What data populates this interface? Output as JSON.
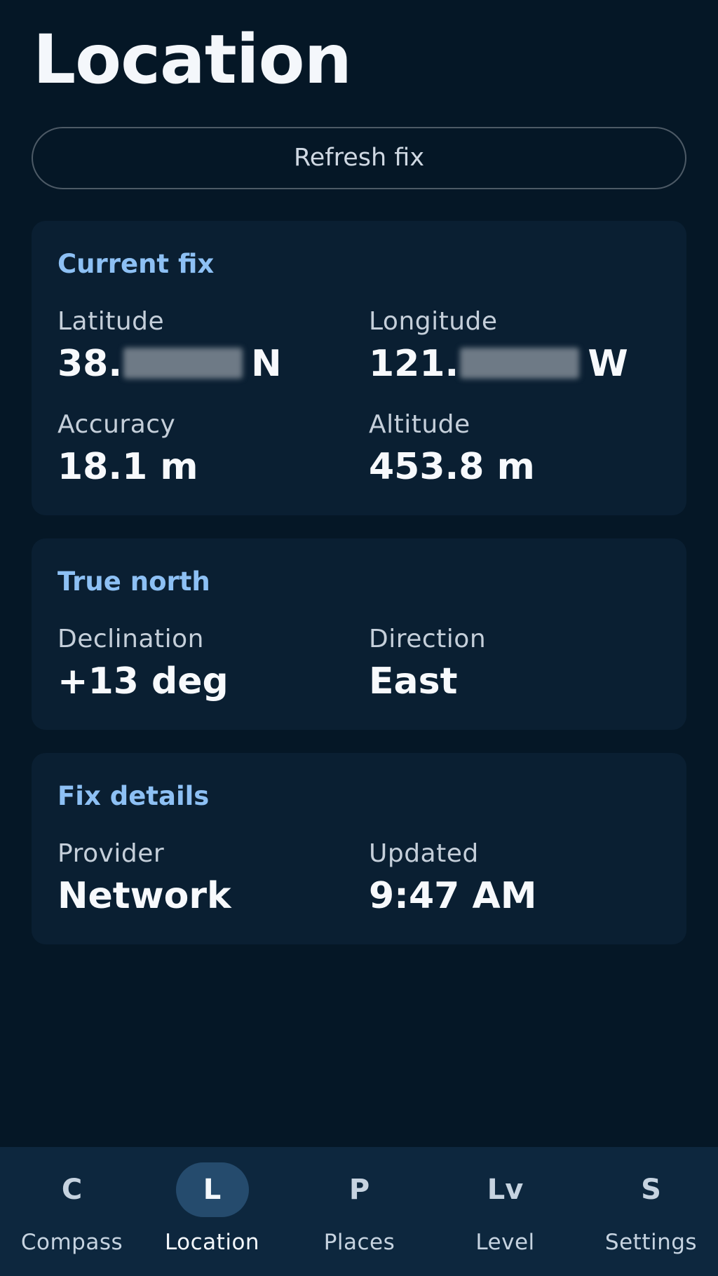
{
  "header": {
    "title": "Location"
  },
  "actions": {
    "refresh_label": "Refresh fix"
  },
  "current_fix": {
    "title": "Current fix",
    "latitude": {
      "label": "Latitude",
      "value_prefix": "38.",
      "value_suffix": "N"
    },
    "longitude": {
      "label": "Longitude",
      "value_prefix": "121.",
      "value_suffix": "W"
    },
    "accuracy": {
      "label": "Accuracy",
      "value": "18.1 m"
    },
    "altitude": {
      "label": "Altitude",
      "value": "453.8 m"
    }
  },
  "true_north": {
    "title": "True north",
    "declination": {
      "label": "Declination",
      "value": "+13 deg"
    },
    "direction": {
      "label": "Direction",
      "value": "East"
    }
  },
  "fix_details": {
    "title": "Fix details",
    "provider": {
      "label": "Provider",
      "value": "Network"
    },
    "updated": {
      "label": "Updated",
      "value": "9:47 AM"
    }
  },
  "bottom_nav": {
    "active": "Location",
    "items": [
      {
        "icon": "C",
        "label": "Compass"
      },
      {
        "icon": "L",
        "label": "Location"
      },
      {
        "icon": "P",
        "label": "Places"
      },
      {
        "icon": "Lv",
        "label": "Level"
      },
      {
        "icon": "S",
        "label": "Settings"
      }
    ]
  },
  "colors": {
    "background": "#051726",
    "card": "#0a1f32",
    "accent": "#8dc0f4",
    "nav_background": "#0d273e",
    "nav_active_pill": "#254b6d"
  }
}
